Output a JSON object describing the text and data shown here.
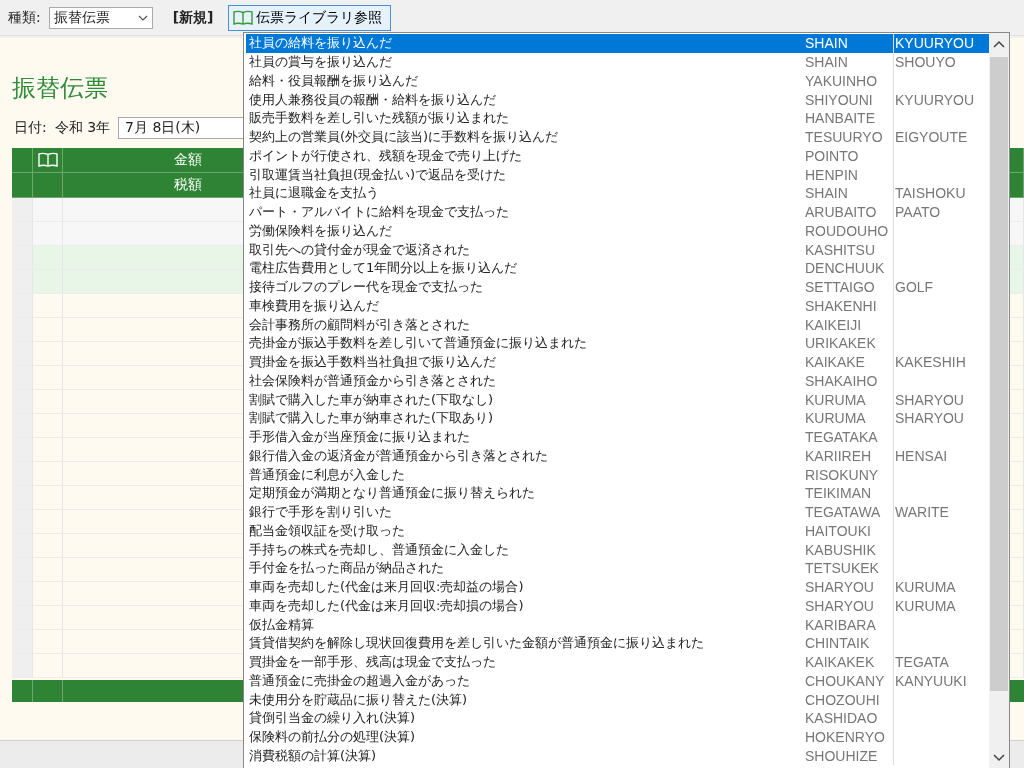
{
  "toolbar": {
    "type_label": "種類:",
    "type_value": "振替伝票",
    "mode": "[新規]",
    "library_button": "伝票ライブラリ参照"
  },
  "form": {
    "title": "振替伝票",
    "date_label": "日付:",
    "era_year": "令和 3年",
    "date_value": "7月 8日(木)"
  },
  "table": {
    "header_row_1": "金額",
    "header_row_2": "税額"
  },
  "library_list": [
    {
      "name": "社員の給料を振り込んだ",
      "code_1": "SHAIN",
      "code_2": "KYUURYOU",
      "selected": true
    },
    {
      "name": "社員の賞与を振り込んだ",
      "code_1": "SHAIN",
      "code_2": "SHOUYO",
      "selected": false
    },
    {
      "name": "給料・役員報酬を振り込んだ",
      "code_1": "YAKUINHO",
      "selected": false
    },
    {
      "name": "使用人兼務役員の報酬・給料を振り込んだ",
      "code_1": "SHIYOUNI",
      "code_2": "KYUURYOU",
      "selected": false
    },
    {
      "name": "販売手数料を差し引いた残額が振り込まれた",
      "code_1": "HANBAITE",
      "selected": false
    },
    {
      "name": "契約上の営業員(外交員に該当)に手数料を振り込んだ",
      "code_1": "TESUURYO",
      "code_2": "EIGYOUTE",
      "selected": false
    },
    {
      "name": "ポイントが行使され、残額を現金で売り上げた",
      "code_1": "POINTO",
      "selected": false
    },
    {
      "name": "引取運賃当社負担(現金払い)で返品を受けた",
      "code_1": "HENPIN",
      "selected": false
    },
    {
      "name": "社員に退職金を支払う",
      "code_1": "SHAIN",
      "code_2": "TAISHOKU",
      "selected": false
    },
    {
      "name": "パート・アルバイトに給料を現金で支払った",
      "code_1": "ARUBAITO",
      "code_2": "PAATO",
      "selected": false
    },
    {
      "name": "労働保険料を振り込んだ",
      "code_1": "ROUDOUHO",
      "selected": false
    },
    {
      "name": "取引先への貸付金が現金で返済された",
      "code_1": "KASHITSU",
      "selected": false
    },
    {
      "name": "電柱広告費用として1年間分以上を振り込んだ",
      "code_1": "DENCHUUK",
      "selected": false
    },
    {
      "name": "接待ゴルフのプレー代を現金で支払った",
      "code_1": "SETTAIGO",
      "code_2": "GOLF",
      "selected": false
    },
    {
      "name": "車検費用を振り込んだ",
      "code_1": "SHAKENHI",
      "selected": false
    },
    {
      "name": "会計事務所の顧問料が引き落とされた",
      "code_1": "KAIKEIJI",
      "selected": false
    },
    {
      "name": "売掛金が振込手数料を差し引いて普通預金に振り込まれた",
      "code_1": "URIKAKEK",
      "selected": false
    },
    {
      "name": "買掛金を振込手数料当社負担で振り込んだ",
      "code_1": "KAIKAKE",
      "code_2": "KAKESHIH",
      "selected": false
    },
    {
      "name": "社会保険料が普通預金から引き落とされた",
      "code_1": "SHAKAIHO",
      "selected": false
    },
    {
      "name": "割賦で購入した車が納車された(下取なし)",
      "code_1": "KURUMA",
      "code_2": "SHARYOU",
      "selected": false
    },
    {
      "name": "割賦で購入した車が納車された(下取あり)",
      "code_1": "KURUMA",
      "code_2": "SHARYOU",
      "selected": false
    },
    {
      "name": "手形借入金が当座預金に振り込まれた",
      "code_1": "TEGATAKA",
      "selected": false
    },
    {
      "name": "銀行借入金の返済金が普通預金から引き落とされた",
      "code_1": "KARIIREH",
      "code_2": "HENSAI",
      "selected": false
    },
    {
      "name": "普通預金に利息が入金した",
      "code_1": "RISOKUNY",
      "selected": false
    },
    {
      "name": "定期預金が満期となり普通預金に振り替えられた",
      "code_1": "TEIKIMAN",
      "selected": false
    },
    {
      "name": "銀行で手形を割り引いた",
      "code_1": "TEGATAWA",
      "code_2": "WARITE",
      "selected": false
    },
    {
      "name": "配当金領収証を受け取った",
      "code_1": "HAITOUKI",
      "selected": false
    },
    {
      "name": "手持ちの株式を売却し、普通預金に入金した",
      "code_1": "KABUSHIK",
      "selected": false
    },
    {
      "name": "手付金を払った商品が納品された",
      "code_1": "TETSUKEK",
      "selected": false
    },
    {
      "name": "車両を売却した(代金は来月回収:売却益の場合)",
      "code_1": "SHARYOU",
      "code_2": "KURUMA",
      "selected": false
    },
    {
      "name": "車両を売却した(代金は来月回収:売却損の場合)",
      "code_1": "SHARYOU",
      "code_2": "KURUMA",
      "selected": false
    },
    {
      "name": "仮払金精算",
      "code_1": "KARIBARA",
      "selected": false
    },
    {
      "name": "賃貸借契約を解除し現状回復費用を差し引いた金額が普通預金に振り込まれた",
      "code_1": "CHINTAIK",
      "selected": false
    },
    {
      "name": "買掛金を一部手形、残高は現金で支払った",
      "code_1": "KAIKAKEK",
      "code_2": "TEGATA",
      "selected": false
    },
    {
      "name": "普通預金に売掛金の超過入金があった",
      "code_1": "CHOUKANY",
      "code_2": "KANYUUKI",
      "selected": false
    },
    {
      "name": "未使用分を貯蔵品に振り替えた(決算)",
      "code_1": "CHOZOUHI",
      "selected": false
    },
    {
      "name": "貸倒引当金の繰り入れ(決算)",
      "code_1": "KASHIDAO",
      "selected": false
    },
    {
      "name": "保険料の前払分の処理(決算)",
      "code_1": "HOKENRYO",
      "selected": false
    },
    {
      "name": "消費税額の計算(決算)",
      "code_1": "SHOUHIZE",
      "selected": false
    }
  ]
}
